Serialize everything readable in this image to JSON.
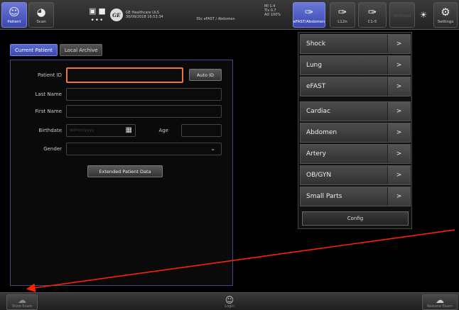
{
  "topbar": {
    "patient": {
      "label": "Patient",
      "icon": "patient-icon"
    },
    "scan": {
      "label": "Scan",
      "icon": "probe-icon"
    },
    "info_lines": [
      "GE Healthcare ULS",
      "30/09/2018 16:53:34"
    ],
    "preset": "3Sc   eFAST / Abdomen",
    "mi_lines": [
      "MI 1.4",
      "TIs 0.7",
      "AO 100%"
    ],
    "probe1": {
      "label": "eFAST/Abdomen",
      "icon": "probe-3sc-icon"
    },
    "probe2": {
      "label": "L12n",
      "icon": "probe-linear-icon"
    },
    "probe3": {
      "label": "C1-5",
      "icon": "probe-convex-icon"
    },
    "disabled_btn": {
      "label": "No Probe"
    },
    "settings": {
      "label": "Settings",
      "icon": "gear-icon"
    }
  },
  "tabs": [
    "Current Patient",
    "Local Archive"
  ],
  "form": {
    "patient_id": {
      "label": "Patient ID",
      "value": ""
    },
    "auto_id": "Auto ID",
    "last_name": {
      "label": "Last Name",
      "value": ""
    },
    "first_name": {
      "label": "First Name",
      "value": ""
    },
    "birthdate": {
      "label": "Birthdate",
      "placeholder": "dd/mm/yyyy"
    },
    "age": {
      "label": "Age",
      "value": ""
    },
    "gender": {
      "label": "Gender",
      "value": ""
    },
    "extended": "Extended Patient Data"
  },
  "menu": {
    "items": [
      "Shock",
      "Lung",
      "eFAST",
      "Cardiac",
      "Abdomen",
      "Artery",
      "OB/GYN",
      "Small Parts"
    ],
    "arrow": ">",
    "config": "Config"
  },
  "bottombar": {
    "left": {
      "label": "Store Exam",
      "icon": "store-icon"
    },
    "mid": {
      "label": "Login",
      "icon": "user-icon"
    },
    "right": {
      "label": "Resume Exam",
      "icon": "resume-icon"
    }
  },
  "colors": {
    "accent": "#4a58c4",
    "focus": "#ee7733",
    "annotation": "#ff2200"
  }
}
